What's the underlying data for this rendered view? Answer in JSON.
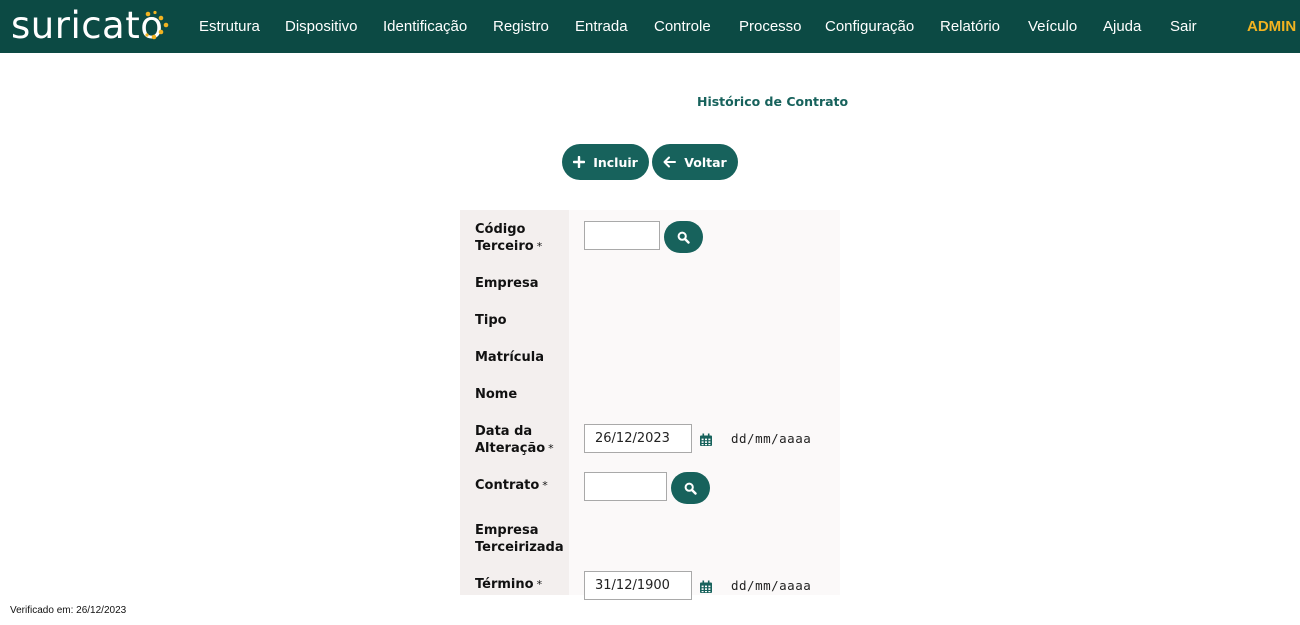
{
  "header": {
    "logo_text": "suricato",
    "menu": [
      "Estrutura",
      "Dispositivo",
      "Identificação",
      "Registro",
      "Entrada",
      "Controle",
      "Processo",
      "Configuração",
      "Relatório",
      "Veículo",
      "Ajuda",
      "Sair"
    ],
    "user": "ADMIN"
  },
  "page": {
    "title": "Histórico de Contrato",
    "buttons": {
      "add": "Incluir",
      "back": "Voltar"
    }
  },
  "form": {
    "codigo_terceiro": {
      "label_line1": "Código",
      "label_line2": "Terceiro",
      "required": "*",
      "value": ""
    },
    "empresa": {
      "label": "Empresa",
      "value": ""
    },
    "tipo": {
      "label": "Tipo",
      "value": ""
    },
    "matricula": {
      "label": "Matrícula",
      "value": ""
    },
    "nome": {
      "label": "Nome",
      "value": ""
    },
    "data_alteracao": {
      "label_line1": "Data da",
      "label_line2": "Alteração",
      "required": "*",
      "value": "26/12/2023",
      "format_hint": "dd/mm/aaaa"
    },
    "contrato": {
      "label": "Contrato",
      "required": "*",
      "value": ""
    },
    "empresa_terceirizada": {
      "label_line1": "Empresa",
      "label_line2": "Terceirizada",
      "value": ""
    },
    "termino": {
      "label": "Término",
      "required": "*",
      "value": "31/12/1900",
      "format_hint": "dd/mm/aaaa"
    }
  },
  "footer": {
    "verified": "Verificado em: 26/12/2023"
  },
  "colors": {
    "header_bg": "#0c4a44",
    "accent": "#17625c",
    "admin": "#f2b320",
    "logo_dot": "#f2b320"
  },
  "icons": {
    "add": "plus-icon",
    "back": "arrow-left-icon",
    "search": "magnifier-icon",
    "calendar": "calendar-icon"
  }
}
